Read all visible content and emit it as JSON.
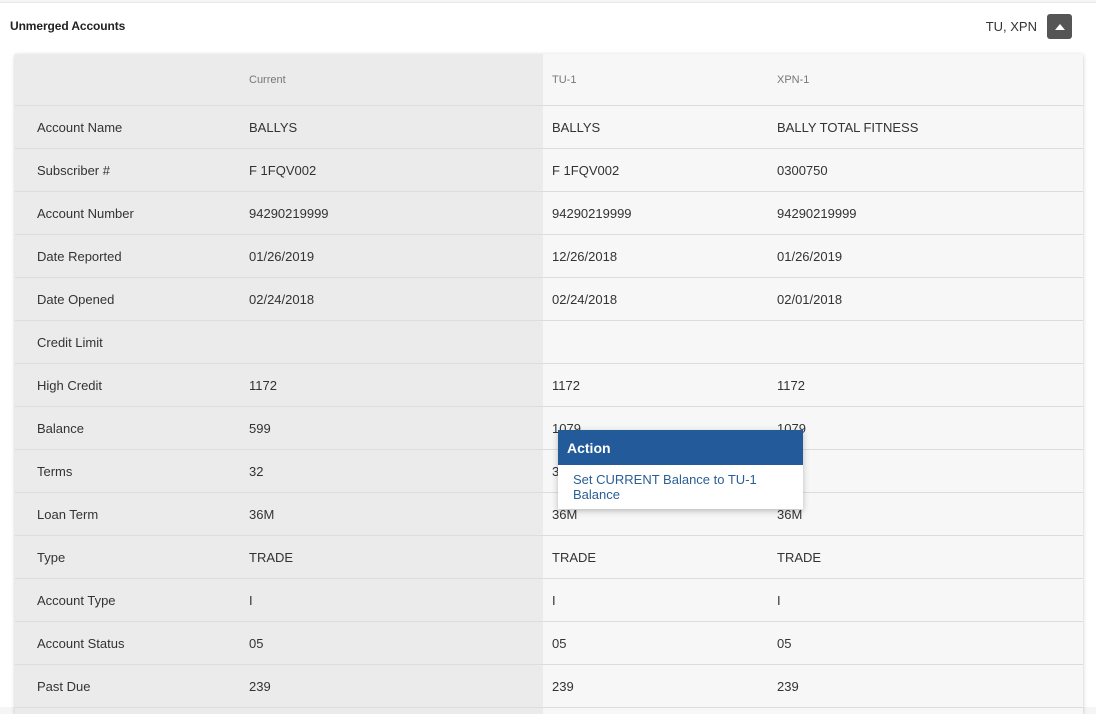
{
  "panel": {
    "title": "Unmerged Accounts",
    "sources": "TU, XPN"
  },
  "columns": {
    "label": "",
    "current": "Current",
    "tu": "TU-1",
    "xpn": "XPN-1"
  },
  "rows": [
    {
      "label": "Account Name",
      "current": "BALLYS",
      "tu": "BALLYS",
      "xpn": "BALLY TOTAL FITNESS"
    },
    {
      "label": "Subscriber #",
      "current": "F 1FQV002",
      "tu": "F 1FQV002",
      "xpn": "0300750"
    },
    {
      "label": "Account Number",
      "current": "94290219999",
      "tu": "94290219999",
      "xpn": "94290219999"
    },
    {
      "label": "Date Reported",
      "current": "01/26/2019",
      "tu": "12/26/2018",
      "xpn": "01/26/2019"
    },
    {
      "label": "Date Opened",
      "current": "02/24/2018",
      "tu": "02/24/2018",
      "xpn": "02/01/2018"
    },
    {
      "label": "Credit Limit",
      "current": "",
      "tu": "",
      "xpn": ""
    },
    {
      "label": "High Credit",
      "current": "1172",
      "tu": "1172",
      "xpn": "1172"
    },
    {
      "label": "Balance",
      "current": "599",
      "tu": "1079",
      "xpn": "1079"
    },
    {
      "label": "Terms",
      "current": "32",
      "tu": "32",
      "xpn": "32"
    },
    {
      "label": "Loan Term",
      "current": "36M",
      "tu": "36M",
      "xpn": "36M"
    },
    {
      "label": "Type",
      "current": "TRADE",
      "tu": "TRADE",
      "xpn": "TRADE"
    },
    {
      "label": "Account Type",
      "current": "I",
      "tu": "I",
      "xpn": "I"
    },
    {
      "label": "Account Status",
      "current": "05",
      "tu": "05",
      "xpn": "05"
    },
    {
      "label": "Past Due",
      "current": "239",
      "tu": "239",
      "xpn": "239"
    }
  ],
  "action_popup": {
    "title": "Action",
    "item": "Set CURRENT Balance to TU-1 Balance"
  },
  "icons": {
    "collapse": "caret-up-icon"
  },
  "colors": {
    "popup_header": "#235b9a",
    "action_link": "#2a5f95",
    "collapse_button": "#555555"
  }
}
